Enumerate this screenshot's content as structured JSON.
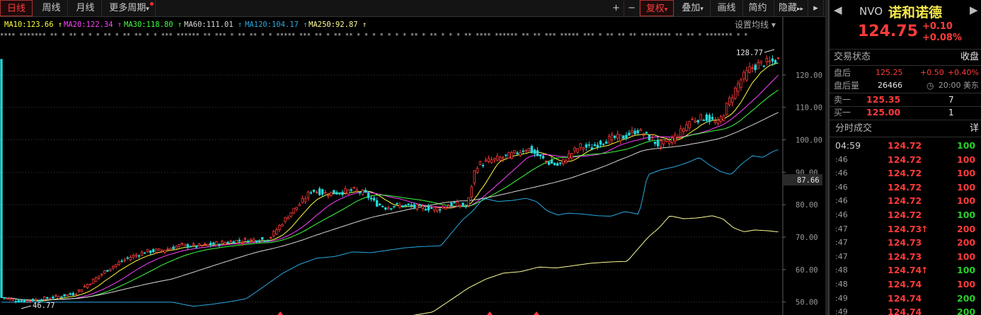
{
  "toolbar": {
    "periods": [
      {
        "label": "日线",
        "active": true
      },
      {
        "label": "周线",
        "active": false
      },
      {
        "label": "月线",
        "active": false
      },
      {
        "label": "更多周期",
        "active": false
      }
    ],
    "right_buttons": [
      {
        "label": "+",
        "active": false
      },
      {
        "label": "−",
        "active": false
      },
      {
        "label": "复权",
        "active": true
      },
      {
        "label": "叠加",
        "active": false
      },
      {
        "label": "画线",
        "active": false
      },
      {
        "label": "简约",
        "active": false
      },
      {
        "label": "隐藏",
        "active": false
      }
    ],
    "more_arrow": "▾",
    "hide_arrows": "▸▸",
    "panel_toggle": "▸"
  },
  "ma_bar": {
    "items": [
      {
        "label": "MA10:123.66",
        "arrow": "↑",
        "color": "#ffff40"
      },
      {
        "label": "MA20:122.34",
        "arrow": "↑",
        "color": "#ff40ff"
      },
      {
        "label": "MA30:118.80",
        "arrow": "↑",
        "color": "#40ff40"
      },
      {
        "label": "MA60:111.01",
        "arrow": "↑",
        "color": "#d8d8d8"
      },
      {
        "label": "MA120:104.17",
        "arrow": "↑",
        "color": "#2aa8e0"
      },
      {
        "label": "MA250:92.87",
        "arrow": "↑",
        "color": "#ffff9a"
      }
    ],
    "settings_label": "设置均线 ▾"
  },
  "chart_data": {
    "type": "candlestick",
    "y_ticks": [
      "120.00",
      "110.00",
      "100.00",
      "90.00",
      "80.00",
      "70.00",
      "60.00",
      "50.00"
    ],
    "current_price_tag": "87.66",
    "high_label": "128.77",
    "low_label": "46.77",
    "ylim": [
      46,
      130
    ],
    "colors": {
      "up": "#ff3b3b",
      "down": "#22d6d6",
      "ma10": "#ffff40",
      "ma20": "#ff40ff",
      "ma30": "#40ff40",
      "ma60": "#d8d8d8",
      "ma120": "#2aa8e0",
      "ma250": "#ffff9a"
    },
    "price_path": [
      [
        0,
        51.5
      ],
      [
        30,
        50.2
      ],
      [
        55,
        50.8
      ],
      [
        80,
        51.6
      ],
      [
        105,
        52.6
      ],
      [
        130,
        56.5
      ],
      [
        155,
        60.5
      ],
      [
        180,
        63.5
      ],
      [
        205,
        65.5
      ],
      [
        230,
        66.0
      ],
      [
        255,
        67.5
      ],
      [
        280,
        67.2
      ],
      [
        305,
        68.0
      ],
      [
        330,
        68.8
      ],
      [
        355,
        69.2
      ],
      [
        380,
        69.4
      ],
      [
        395,
        73.5
      ],
      [
        410,
        77.5
      ],
      [
        425,
        80.5
      ],
      [
        440,
        84.5
      ],
      [
        460,
        83.5
      ],
      [
        480,
        83.8
      ],
      [
        500,
        84.5
      ],
      [
        515,
        83.5
      ],
      [
        530,
        80.5
      ],
      [
        545,
        79.2
      ],
      [
        560,
        79.8
      ],
      [
        580,
        79.5
      ],
      [
        600,
        79.0
      ],
      [
        620,
        78.8
      ],
      [
        640,
        80.3
      ],
      [
        660,
        79.4
      ],
      [
        672,
        92.0
      ],
      [
        690,
        93.5
      ],
      [
        710,
        94.5
      ],
      [
        730,
        96.0
      ],
      [
        745,
        97.5
      ],
      [
        760,
        95.0
      ],
      [
        775,
        93.0
      ],
      [
        790,
        92.0
      ],
      [
        805,
        95.5
      ],
      [
        820,
        98.0
      ],
      [
        835,
        97.5
      ],
      [
        850,
        99.5
      ],
      [
        865,
        100.5
      ],
      [
        880,
        100.8
      ],
      [
        900,
        103.0
      ],
      [
        915,
        101.0
      ],
      [
        930,
        98.5
      ],
      [
        945,
        99.5
      ],
      [
        960,
        102.0
      ],
      [
        975,
        106.0
      ],
      [
        995,
        107.0
      ],
      [
        1015,
        105.0
      ],
      [
        1030,
        112.0
      ],
      [
        1045,
        118.0
      ],
      [
        1060,
        122.0
      ],
      [
        1075,
        123.5
      ],
      [
        1090,
        124.0
      ],
      [
        1100,
        124.75
      ]
    ]
  },
  "marker_strip": "**** *******  ** *  **  * *    * **     *    **  ** * *  *** ****** ** *** * **  **     * * *****  *** ** *  **  ** * *  * * *   * * ** *  **  * * *    ** **** ******  ** **  ***  *****  ***  * ** ** **  ******** ** ** *  ******* * *",
  "quote": {
    "symbol": "NVO",
    "name": "诺和诺德",
    "price": "124.75",
    "change": "+0.10",
    "change_pct": "+0.08%",
    "status_label": "交易状态",
    "status_value": "收盘",
    "after_label": "盘后",
    "after_price": "125.25",
    "after_change": "+0.50",
    "after_pct": "+0.40%",
    "after_vol_label": "盘后量",
    "after_vol": "26466",
    "after_time": "20:00 美东",
    "clock_icon": "◷",
    "sell_label": "卖一",
    "sell_price": "125.35",
    "sell_qty": "7",
    "buy_label": "买一",
    "buy_price": "125.00",
    "buy_qty": "1",
    "prev_arrow": "◀",
    "next_arrow": "▶"
  },
  "trades_header": {
    "label": "分时成交",
    "detail": "详"
  },
  "trades": [
    {
      "time": "04:59",
      "price": "124.72",
      "up": "",
      "vol": "100",
      "vol_color": "green",
      "full": true
    },
    {
      "time": ":46",
      "price": "124.72",
      "up": "",
      "vol": "100",
      "vol_color": "red",
      "full": false
    },
    {
      "time": ":46",
      "price": "124.72",
      "up": "",
      "vol": "100",
      "vol_color": "red",
      "full": false
    },
    {
      "time": ":46",
      "price": "124.72",
      "up": "",
      "vol": "100",
      "vol_color": "red",
      "full": false
    },
    {
      "time": ":46",
      "price": "124.72",
      "up": "",
      "vol": "100",
      "vol_color": "red",
      "full": false
    },
    {
      "time": ":46",
      "price": "124.72",
      "up": "",
      "vol": "100",
      "vol_color": "green",
      "full": false
    },
    {
      "time": ":47",
      "price": "124.73",
      "up": "↑",
      "vol": "200",
      "vol_color": "red",
      "full": false
    },
    {
      "time": ":47",
      "price": "124.73",
      "up": "",
      "vol": "200",
      "vol_color": "red",
      "full": false
    },
    {
      "time": ":47",
      "price": "124.73",
      "up": "",
      "vol": "100",
      "vol_color": "red",
      "full": false
    },
    {
      "time": ":48",
      "price": "124.74",
      "up": "↑",
      "vol": "100",
      "vol_color": "green",
      "full": false
    },
    {
      "time": ":48",
      "price": "124.74",
      "up": "",
      "vol": "100",
      "vol_color": "red",
      "full": false
    },
    {
      "time": ":49",
      "price": "124.74",
      "up": "",
      "vol": "200",
      "vol_color": "green",
      "full": false
    },
    {
      "time": ":49",
      "price": "124.74",
      "up": "",
      "vol": "200",
      "vol_color": "green",
      "full": false
    }
  ]
}
